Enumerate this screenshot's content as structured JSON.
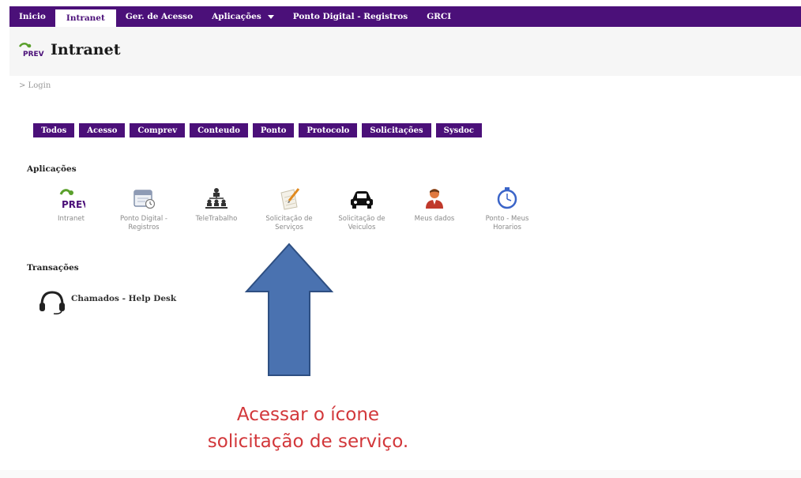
{
  "nav": {
    "tabs": [
      {
        "label": "Inicio"
      },
      {
        "label": "Intranet",
        "active": true
      },
      {
        "label": "Ger. de Acesso"
      },
      {
        "label": "Aplicações",
        "has_dropdown": true
      },
      {
        "label": "Ponto Digital - Registros"
      },
      {
        "label": "GRCI"
      }
    ]
  },
  "brand": {
    "logo_text": "PREV",
    "title": "Intranet"
  },
  "breadcrumb": "> Login",
  "categories": [
    "Todos",
    "Acesso",
    "Comprev",
    "Conteudo",
    "Ponto",
    "Protocolo",
    "Solicitações",
    "Sysdoc"
  ],
  "sections": {
    "apps_title": "Aplicações",
    "transactions_title": "Transações"
  },
  "apps": [
    {
      "label": "Intranet",
      "icon": "prev-logo-icon"
    },
    {
      "label": "Ponto Digital - Registros",
      "icon": "calendar-clock-icon"
    },
    {
      "label": "TeleTrabalho",
      "icon": "org-chart-icon"
    },
    {
      "label": "Solicitação de Serviços",
      "icon": "notepad-pencil-icon"
    },
    {
      "label": "Solicitação de Veiculos",
      "icon": "car-icon"
    },
    {
      "label": "Meus dados",
      "icon": "user-icon"
    },
    {
      "label": "Ponto - Meus Horarios",
      "icon": "stopwatch-icon"
    }
  ],
  "transactions": [
    {
      "label": "Chamados - Help Desk",
      "icon": "headset-icon"
    }
  ],
  "annotation": {
    "line1": "Acessar  o ícone",
    "line2": "solicitação de serviço."
  },
  "colors": {
    "nav_bg": "#4b1079",
    "caption": "#d2373a",
    "arrow_fill": "#4a72b0"
  }
}
